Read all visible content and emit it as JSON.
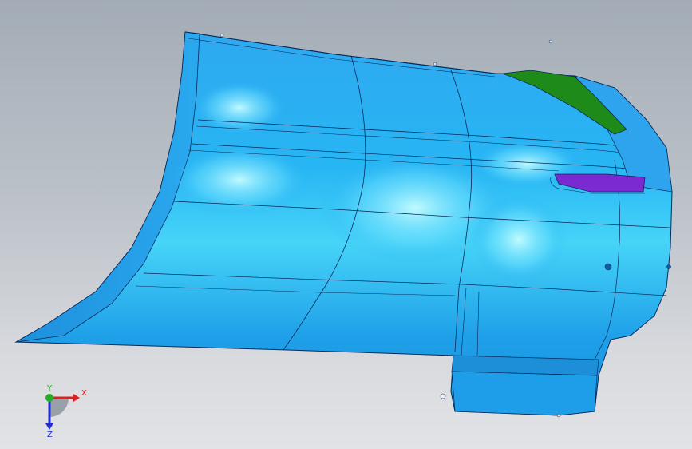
{
  "viewport": {
    "background_top": "#a3acb6",
    "background_bottom": "#e2e3e6"
  },
  "model": {
    "surface_color": "#1ea6ee",
    "highlight_color": "#b8fbff",
    "edge_color": "#0a2a5a",
    "green_face_color": "#1e8a1a",
    "purple_face_color": "#7a2ad0"
  },
  "triad": {
    "x_label": "X",
    "y_label": "Y",
    "z_label": "Z",
    "x_color": "#e02020",
    "y_color": "#20b020",
    "z_color": "#2030d0"
  }
}
